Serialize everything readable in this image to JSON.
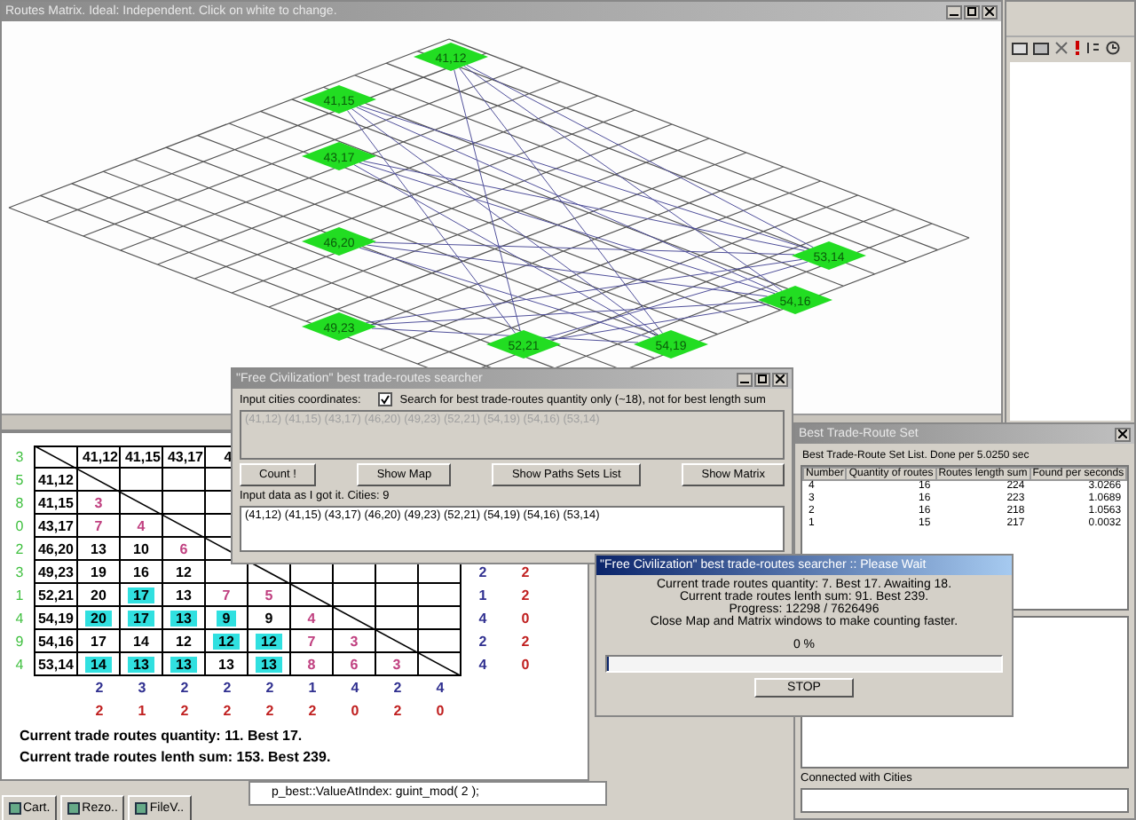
{
  "map_window": {
    "title": "Routes Matrix.  Ideal: Independent.  Click on white to change.",
    "cities": [
      "41,12",
      "41,15",
      "43,17",
      "46,20",
      "49,23",
      "52,21",
      "54,19",
      "54,16",
      "53,14"
    ]
  },
  "matrix": {
    "corner_count": "3",
    "columns": [
      "41,12",
      "41,15",
      "43,17",
      "4"
    ],
    "rows": [
      {
        "count": "5",
        "label": "41,12",
        "cells": []
      },
      {
        "count": "8",
        "label": "41,15",
        "cells": [
          {
            "text": "3",
            "highlighted": false,
            "kind": "near"
          }
        ]
      },
      {
        "count": "0",
        "label": "43,17",
        "cells": [
          {
            "text": "7",
            "highlighted": false,
            "kind": "near"
          },
          {
            "text": "4",
            "highlighted": false,
            "kind": "near"
          }
        ]
      },
      {
        "count": "2",
        "label": "46,20",
        "cells": [
          {
            "text": "13",
            "highlighted": false,
            "kind": "far"
          },
          {
            "text": "10",
            "highlighted": false,
            "kind": "far"
          },
          {
            "text": "6",
            "highlighted": false,
            "kind": "near"
          }
        ]
      },
      {
        "count": "3",
        "label": "49,23",
        "cells": [
          {
            "text": "19",
            "highlighted": false,
            "kind": "far"
          },
          {
            "text": "16",
            "highlighted": false,
            "kind": "far"
          },
          {
            "text": "12",
            "highlighted": false,
            "kind": "far"
          }
        ],
        "sum_a": "2",
        "sum_b": "2"
      },
      {
        "count": "1",
        "label": "52,21",
        "cells": [
          {
            "text": "20",
            "highlighted": false,
            "kind": "far"
          },
          {
            "text": "17",
            "highlighted": true,
            "kind": "far"
          },
          {
            "text": "13",
            "highlighted": false,
            "kind": "far"
          },
          {
            "text": "7",
            "highlighted": false,
            "kind": "near"
          },
          {
            "text": "5",
            "highlighted": false,
            "kind": "near"
          }
        ],
        "sum_a": "1",
        "sum_b": "2"
      },
      {
        "count": "4",
        "label": "54,19",
        "cells": [
          {
            "text": "20",
            "highlighted": true,
            "kind": "far"
          },
          {
            "text": "17",
            "highlighted": true,
            "kind": "far"
          },
          {
            "text": "13",
            "highlighted": true,
            "kind": "far"
          },
          {
            "text": "9",
            "highlighted": true,
            "kind": "far"
          },
          {
            "text": "9",
            "highlighted": false,
            "kind": "far"
          },
          {
            "text": "4",
            "highlighted": false,
            "kind": "near"
          }
        ],
        "sum_a": "4",
        "sum_b": "0"
      },
      {
        "count": "9",
        "label": "54,16",
        "cells": [
          {
            "text": "17",
            "highlighted": false,
            "kind": "far"
          },
          {
            "text": "14",
            "highlighted": false,
            "kind": "far"
          },
          {
            "text": "12",
            "highlighted": false,
            "kind": "far"
          },
          {
            "text": "12",
            "highlighted": true,
            "kind": "far"
          },
          {
            "text": "12",
            "highlighted": true,
            "kind": "far"
          },
          {
            "text": "7",
            "highlighted": false,
            "kind": "near"
          },
          {
            "text": "3",
            "highlighted": false,
            "kind": "near"
          }
        ],
        "sum_a": "2",
        "sum_b": "2"
      },
      {
        "count": "4",
        "label": "53,14",
        "cells": [
          {
            "text": "14",
            "highlighted": true,
            "kind": "far"
          },
          {
            "text": "13",
            "highlighted": true,
            "kind": "far"
          },
          {
            "text": "13",
            "highlighted": true,
            "kind": "far"
          },
          {
            "text": "13",
            "highlighted": false,
            "kind": "far"
          },
          {
            "text": "13",
            "highlighted": true,
            "kind": "far"
          },
          {
            "text": "8",
            "highlighted": false,
            "kind": "near"
          },
          {
            "text": "6",
            "highlighted": false,
            "kind": "near"
          },
          {
            "text": "3",
            "highlighted": false,
            "kind": "near"
          }
        ],
        "sum_a": "4",
        "sum_b": "0"
      }
    ],
    "totals_a": [
      "2",
      "3",
      "2",
      "2",
      "2",
      "1",
      "4",
      "2",
      "4"
    ],
    "totals_b": [
      "2",
      "1",
      "2",
      "2",
      "2",
      "2",
      "0",
      "2",
      "0"
    ],
    "status_lines": [
      "Current trade routes quantity: 11. Best 17.",
      "Current trade routes lenth sum: 153. Best 239."
    ]
  },
  "code_line": "p_best::ValueAtIndex: guint_mod( 2 );",
  "searcher": {
    "title": "\"Free Civilization\" best trade-routes searcher",
    "input_label": "Input cities coordinates:",
    "option": {
      "label": "Search for best trade-routes quantity only (~18), not for best length sum",
      "checked": true
    },
    "input_value": "(41,12) (41,15) (43,17) (46,20) (49,23) (52,21) (54,19) (54,16) (53,14)",
    "buttons": [
      "Count !",
      "Show Map",
      "Show Paths Sets List",
      "Show Matrix"
    ],
    "data_label": "Input data as I got it. Cities: 9",
    "data_value": "(41,12) (41,15) (43,17) (46,20) (49,23) (52,21) (54,19) (54,16) (53,14)"
  },
  "best_set": {
    "title": "Best Trade-Route Set",
    "summary": "Best Trade-Route Set List. Done per 5.0250 sec",
    "columns": [
      "Number",
      "Quantity of routes",
      "Routes length sum",
      "Found per seconds"
    ],
    "rows": [
      [
        "4",
        "16",
        "224",
        "3.0266"
      ],
      [
        "3",
        "16",
        "223",
        "1.0689"
      ],
      [
        "2",
        "16",
        "218",
        "1.0563"
      ],
      [
        "1",
        "15",
        "217",
        "0.0032"
      ]
    ],
    "connected_label": "Connected with Cities"
  },
  "progress": {
    "title": "\"Free Civilization\" best trade-routes searcher :: Please Wait",
    "lines": [
      "Current trade routes quantity: 7. Best 17. Awaiting 18.",
      "Current trade routes lenth sum: 91. Best 239.",
      "Progress: 12298 / 7626496",
      "Close Map and Matrix windows to make counting faster."
    ],
    "percent": "0 %",
    "level": 0,
    "button": "STOP"
  },
  "taskbar": [
    "Cart.",
    "Rezo..",
    "FileV.."
  ]
}
